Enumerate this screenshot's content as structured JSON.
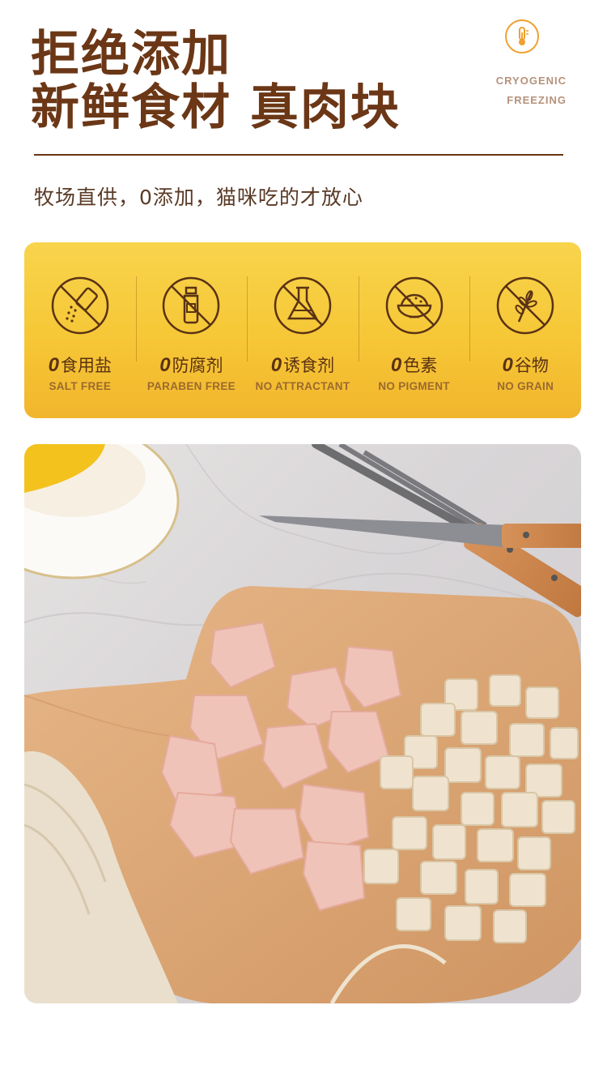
{
  "header": {
    "title_line1": "拒绝添加",
    "title_line2": "新鲜食材 真肉块",
    "badge": {
      "icon": "thermometer-icon",
      "line1": "CRYOGENIC",
      "line2": "FREEZING"
    }
  },
  "subtitle": "牧场直供，0添加，猫咪吃的才放心",
  "features": [
    {
      "zero": "0",
      "label": "食用盐",
      "sub": "SALT FREE",
      "icon": "salt-shaker-crossed-icon"
    },
    {
      "zero": "0",
      "label": "防腐剂",
      "sub": "PARABEN FREE",
      "icon": "bottle-crossed-icon"
    },
    {
      "zero": "0",
      "label": "诱食剂",
      "sub": "NO ATTRACTANT",
      "icon": "flask-crossed-icon"
    },
    {
      "zero": "0",
      "label": "色素",
      "sub": "NO PIGMENT",
      "icon": "bowl-crossed-icon"
    },
    {
      "zero": "0",
      "label": "谷物",
      "sub": "NO GRAIN",
      "icon": "wheat-crossed-icon"
    }
  ],
  "colors": {
    "brown": "#6b3716",
    "panel_yellow": "#f6c736",
    "accent_orange": "#f0a030"
  },
  "photo": {
    "subject": "product-photo"
  }
}
